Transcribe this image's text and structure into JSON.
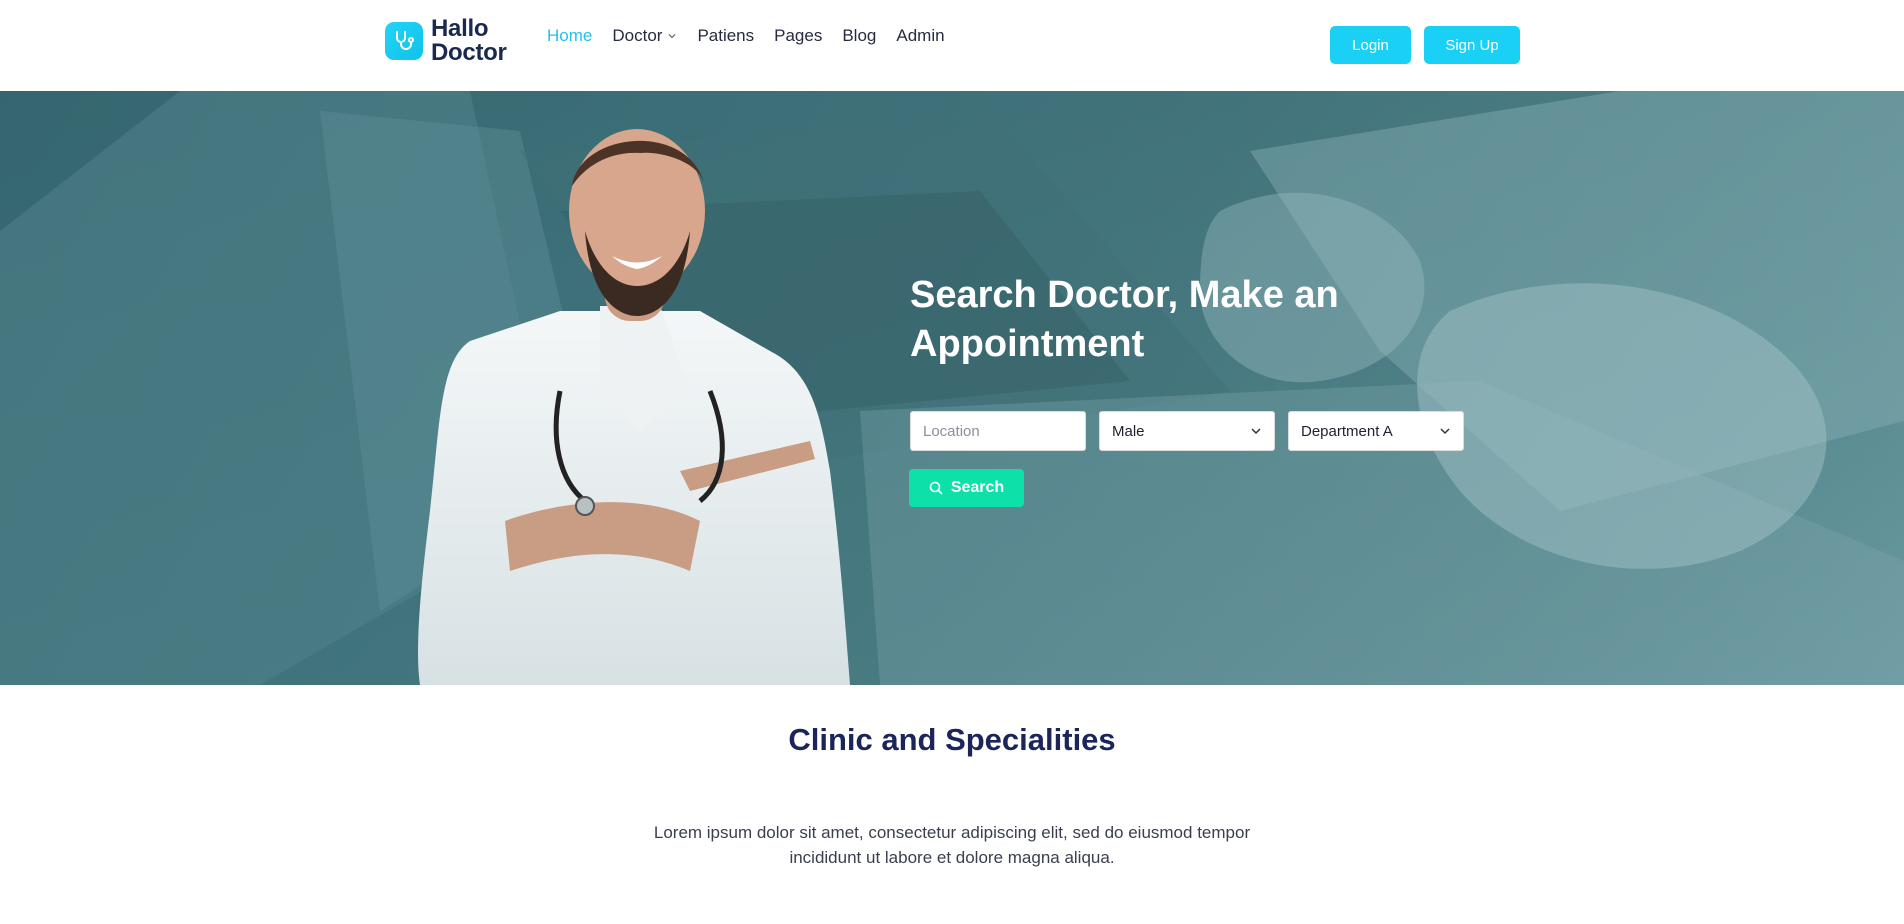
{
  "brand": {
    "line1": "Hallo",
    "line2": "Doctor",
    "icon": "stethoscope-icon",
    "accent": "#1fc2e8"
  },
  "nav": {
    "items": [
      {
        "label": "Home",
        "active": true
      },
      {
        "label": "Doctor",
        "has_dropdown": true
      },
      {
        "label": "Patiens"
      },
      {
        "label": "Pages"
      },
      {
        "label": "Blog"
      },
      {
        "label": "Admin"
      }
    ]
  },
  "auth": {
    "login_label": "Login",
    "signup_label": "Sign Up",
    "button_color": "#1ad0f5"
  },
  "hero": {
    "title": "Search Doctor, Make an Appointment",
    "location_placeholder": "Location",
    "gender_value": "Male",
    "department_value": "Department A",
    "search_label": "Search",
    "search_color": "#0de0a8"
  },
  "section": {
    "title": "Clinic and Specialities",
    "description": "Lorem ipsum dolor sit amet, consectetur adipiscing elit, sed do eiusmod tempor incididunt ut labore et dolore magna aliqua."
  }
}
